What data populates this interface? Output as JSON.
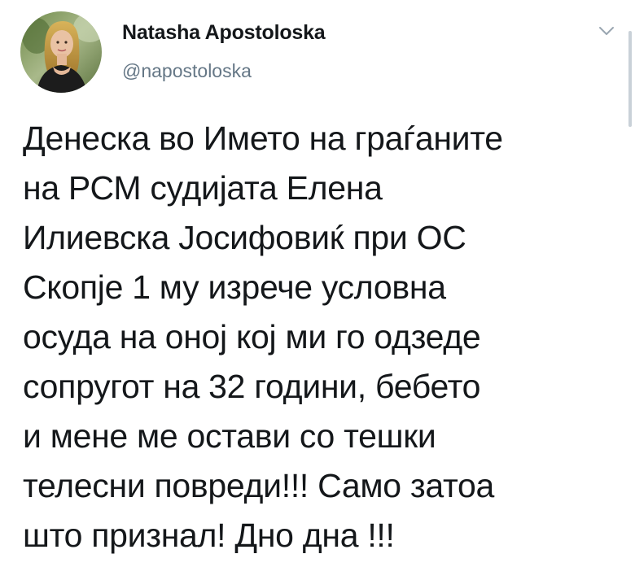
{
  "author": {
    "display_name": "Natasha Apostoloska",
    "handle": "@napostoloska",
    "avatar_icon": "profile-photo"
  },
  "tweet": {
    "lines": [
      "Денеска во Името на граѓаните",
      "на РСМ судијата Елена",
      "Илиевска Јосифовиќ при ОС",
      "Скопје 1 му изрече условна",
      "осуда на оној кој ми го одзеде",
      "сопругот на 32 години, бебето",
      "и мене ме остави со тешки",
      "телесни повреди!!! Само затоа",
      "што признал! Дно дна !!!"
    ]
  },
  "menu": {
    "icon": "chevron-down-icon"
  },
  "colors": {
    "text": "#14171a",
    "secondary_text": "#657786",
    "background": "#ffffff"
  }
}
